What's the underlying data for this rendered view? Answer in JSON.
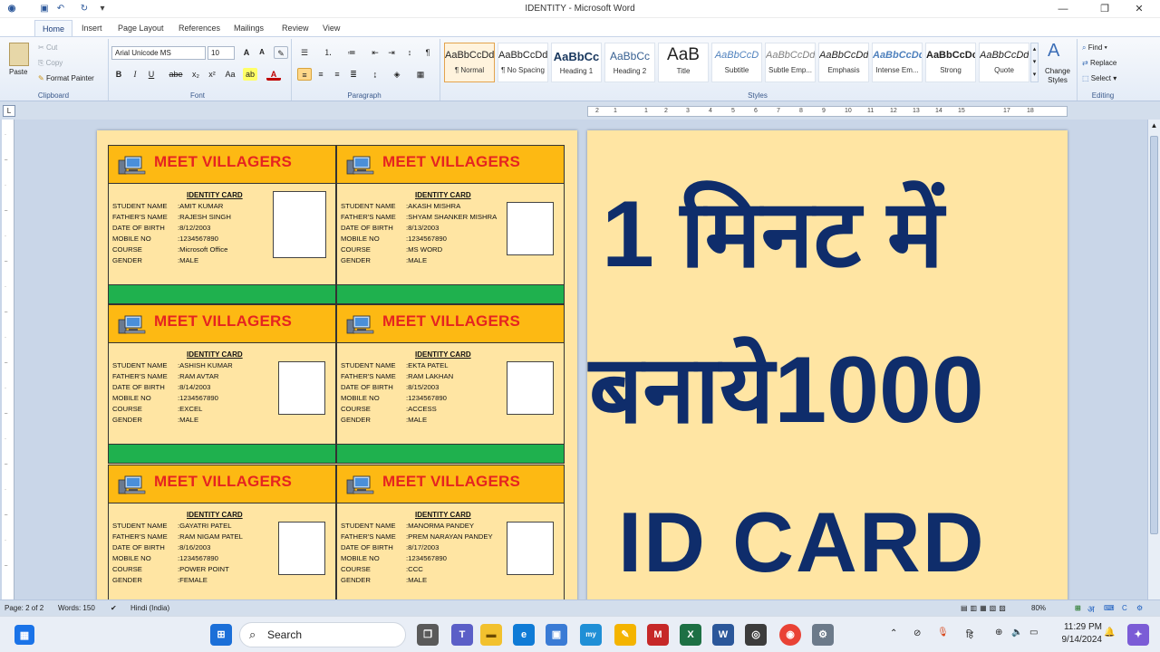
{
  "window": {
    "title": "IDENTITY - Microsoft Word",
    "minimize": "—",
    "restore": "❐",
    "close": "✕"
  },
  "quick_access": [
    "save-icon",
    "undo-icon",
    "redo-icon",
    "customize-icon"
  ],
  "tabs": [
    {
      "label": "Home",
      "active": true
    },
    {
      "label": "Insert"
    },
    {
      "label": "Page Layout"
    },
    {
      "label": "References"
    },
    {
      "label": "Mailings"
    },
    {
      "label": "Review"
    },
    {
      "label": "View"
    }
  ],
  "ribbon": {
    "clipboard": {
      "label": "Clipboard",
      "paste": "Paste",
      "cut": "Cut",
      "copy": "Copy",
      "format_painter": "Format Painter"
    },
    "font": {
      "label": "Font",
      "family": "Arial Unicode MS",
      "size": "10"
    },
    "paragraph": {
      "label": "Paragraph"
    },
    "styles": {
      "label": "Styles",
      "items": [
        {
          "preview": "AaBbCcDd",
          "name": "¶ Normal"
        },
        {
          "preview": "AaBbCcDd",
          "name": "¶ No Spacing"
        },
        {
          "preview": "AaBbCc",
          "name": "Heading 1"
        },
        {
          "preview": "AaBbCc",
          "name": "Heading 2"
        },
        {
          "preview": "AaB",
          "name": "Title"
        },
        {
          "preview": "AaBbCcD",
          "name": "Subtitle"
        },
        {
          "preview": "AaBbCcDd",
          "name": "Subtle Emp..."
        },
        {
          "preview": "AaBbCcDd",
          "name": "Emphasis"
        },
        {
          "preview": "AaBbCcDd",
          "name": "Intense Em..."
        },
        {
          "preview": "AaBbCcDc",
          "name": "Strong"
        },
        {
          "preview": "AaBbCcDd",
          "name": "Quote"
        }
      ],
      "change_styles": "Change Styles"
    },
    "editing": {
      "label": "Editing",
      "find": "Find",
      "replace": "Replace",
      "select": "Select"
    }
  },
  "ruler_marks": [
    "2",
    "1",
    "1",
    "2",
    "3",
    "4",
    "5",
    "6",
    "7",
    "8",
    "9",
    "10",
    "11",
    "12",
    "13",
    "14",
    "15",
    "17",
    "18"
  ],
  "cards": [
    {
      "brand": "MEET VILLAGERS",
      "heading": "IDENTITY CARD",
      "student": "AMIT KUMAR",
      "father": "RAJESH SINGH",
      "dob": "8/12/2003",
      "mobile": "1234567890",
      "course": "Microsoft Office",
      "gender": "MALE"
    },
    {
      "brand": "MEET VILLAGERS",
      "heading": "IDENTITY CARD",
      "student": "AKASH MISHRA",
      "father": "SHYAM SHANKER MISHRA",
      "dob": "8/13/2003",
      "mobile": "1234567890",
      "course": "MS WORD",
      "gender": "MALE"
    },
    {
      "brand": "MEET VILLAGERS",
      "heading": "IDENTITY CARD",
      "student": "ASHISH KUMAR",
      "father": "RAM AVTAR",
      "dob": "8/14/2003",
      "mobile": "1234567890",
      "course": "EXCEL",
      "gender": "MALE"
    },
    {
      "brand": "MEET VILLAGERS",
      "heading": "IDENTITY CARD",
      "student": "EKTA PATEL",
      "father": "RAM LAKHAN",
      "dob": "8/15/2003",
      "mobile": "1234567890",
      "course": "ACCESS",
      "gender": "MALE"
    },
    {
      "brand": "MEET VILLAGERS",
      "heading": "IDENTITY CARD",
      "student": "GAYATRI PATEL",
      "father": "RAM NIGAM PATEL",
      "dob": "8/16/2003",
      "mobile": "1234567890",
      "course": "POWER POINT",
      "gender": "FEMALE"
    },
    {
      "brand": "MEET VILLAGERS",
      "heading": "IDENTITY CARD",
      "student": "MANORMA PANDEY",
      "father": "PREM NARAYAN PANDEY",
      "dob": "8/17/2003",
      "mobile": "1234567890",
      "course": "CCC",
      "gender": "MALE"
    }
  ],
  "field_labels": {
    "student": "STUDENT NAME",
    "father": "FATHER'S NAME",
    "dob": "DATE OF BIRTH",
    "mobile": "MOBILE NO",
    "course": "COURSE",
    "gender": "GENDER"
  },
  "right_page": {
    "line1": "1 मिनट में",
    "line2": "बनाये1000",
    "line3": "ID CARD"
  },
  "status": {
    "page": "Page: 2 of 2",
    "words": "Words: 150",
    "language": "Hindi (India)",
    "zoom": "80%",
    "ime_lang": "अ"
  },
  "taskbar": {
    "search": "Search",
    "time": "11:29 PM",
    "date": "9/14/2024"
  },
  "colors": {
    "card_header": "#fdb913",
    "card_bg": "#ffe5a3",
    "brand_text": "#e52421",
    "stripe": "#1fb14e",
    "big_text": "#0f2d6b"
  }
}
